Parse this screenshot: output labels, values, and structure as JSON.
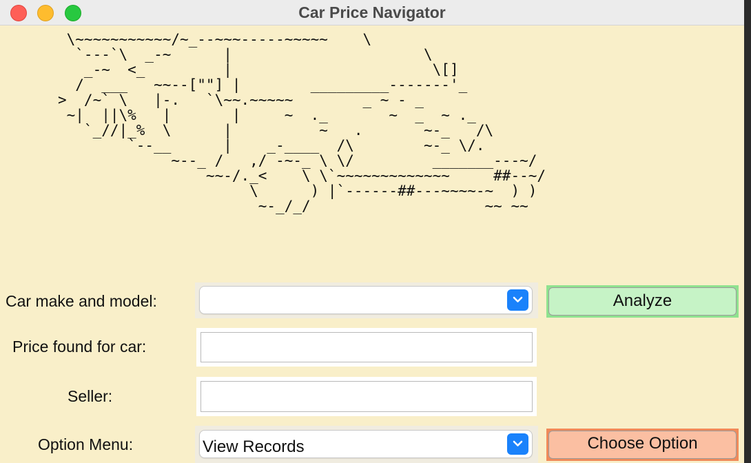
{
  "window": {
    "title": "Car Price Navigator"
  },
  "ascii_art": " \\~~~~~~~~~~~/~_--~~~-----~~~~~    \\\n  `---`\\  _-~      |                      \\\n   _-~  <_         |                       \\[]\n  /  ___   ~~--[\"\"] |        _________-------'_\n>  /~` \\   |-.   `\\~~.~~~~~        _ ~ - _\n ~|  ||\\%   |       |     ~  ._       ~  _  ~ ._\n   `_//|_%  \\      |          ~   .       ~-_   /\\\n        `--__      |    _-____  /\\        ~-_ \\/.\n             ~--_ /   ,/ -~-_ \\ \\/         _______---~/\n                 ~~-/._<    \\ \\`~~~~~~~~~~~~~     ##--~/\n                      \\      ) |`------##---~~~~-~  ) )\n                       ~-_/_/                    ~~ ~~",
  "form": {
    "make_model_label": "Car make and model:",
    "make_model_value": "",
    "price_label": "Price found for car:",
    "price_value": "",
    "seller_label": "Seller:",
    "seller_value": "",
    "option_label": "Option Menu:",
    "option_value": "View Records"
  },
  "buttons": {
    "analyze": "Analyze",
    "choose_option": "Choose Option"
  },
  "colors": {
    "background": "#f9efc9",
    "analyze_button": "#c6f3c6",
    "analyze_border": "#8fe28f",
    "choose_button": "#fbbfa2",
    "choose_border": "#f08a5a",
    "chevron": "#1a82fb"
  }
}
